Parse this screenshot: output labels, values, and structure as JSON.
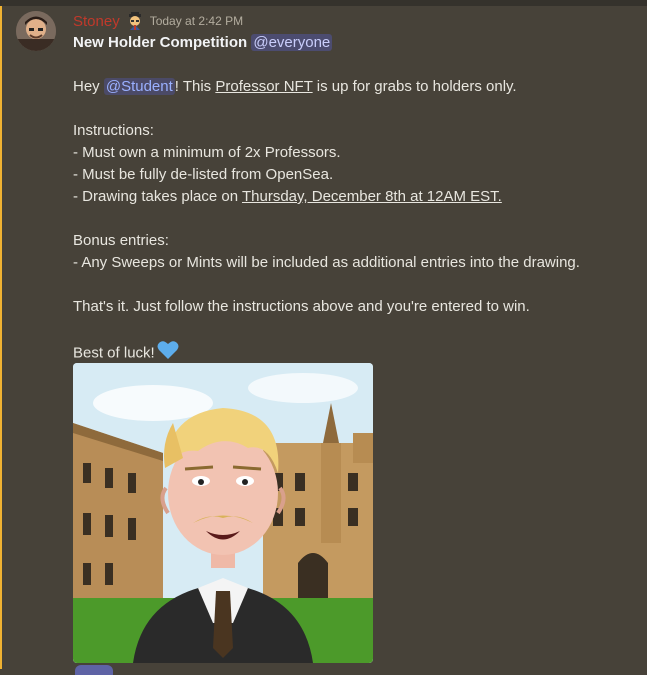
{
  "message": {
    "username": "Stoney",
    "timestamp": "Today at 2:42 PM",
    "role_icon": "professor-icon",
    "title": "New Holder Competition",
    "title_mention": "@everyone",
    "intro_prefix": "Hey ",
    "intro_mention": "@Student",
    "intro_middle": "! This ",
    "intro_link": "Professor NFT",
    "intro_suffix": " is up for grabs to holders only.",
    "instructions_heading": "Instructions:",
    "instruction_1": "- Must own a minimum of 2x Professors.",
    "instruction_2": "- Must be fully de-listed from OpenSea.",
    "instruction_3_prefix": "- Drawing takes place on ",
    "instruction_3_date": "Thursday, December 8th at 12AM EST.",
    "bonus_heading": "Bonus entries:",
    "bonus_1": "- Any Sweeps or Mints will be included as additional entries into the drawing.",
    "closing": "That's it. Just follow the instructions above and you're entered to win.",
    "signoff": "Best of luck!",
    "signoff_emoji": "blue-heart-icon"
  },
  "colors": {
    "background": "#474239",
    "username": "#c0392b",
    "mention_bar": "#f0b232",
    "mention_bg": "#5865f2"
  },
  "image": {
    "subject": "professor-nft-artwork"
  }
}
